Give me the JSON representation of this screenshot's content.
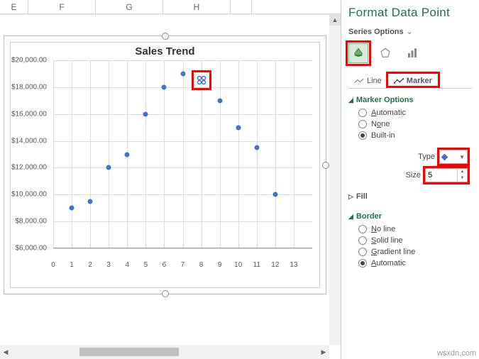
{
  "columns": [
    "E",
    "F",
    "G",
    "H"
  ],
  "chart_data": {
    "type": "scatter",
    "title": "Sales Trend",
    "ylabel": "",
    "xlabel": "",
    "ylim": [
      6000,
      20000
    ],
    "xlim": [
      0,
      14
    ],
    "y_ticks": [
      "$6,000.00",
      "$8,000.00",
      "$10,000.00",
      "$12,000.00",
      "$14,000.00",
      "$16,000.00",
      "$18,000.00",
      "$20,000.00"
    ],
    "x_ticks": [
      0,
      1,
      2,
      3,
      4,
      5,
      6,
      7,
      8,
      9,
      10,
      11,
      12,
      13
    ],
    "series": [
      {
        "name": "Sales",
        "points": [
          {
            "x": 1,
            "y": 9000
          },
          {
            "x": 2,
            "y": 9500
          },
          {
            "x": 3,
            "y": 12000
          },
          {
            "x": 4,
            "y": 13000
          },
          {
            "x": 5,
            "y": 16000
          },
          {
            "x": 6,
            "y": 18000
          },
          {
            "x": 7,
            "y": 19000
          },
          {
            "x": 8,
            "y": 18500
          },
          {
            "x": 9,
            "y": 17000
          },
          {
            "x": 10,
            "y": 15000
          },
          {
            "x": 11,
            "y": 13500
          },
          {
            "x": 12,
            "y": 10000
          }
        ]
      }
    ],
    "selected_point_index": 7
  },
  "pane": {
    "title": "Format Data Point",
    "series_options": "Series Options",
    "tabs": {
      "line": "Line",
      "marker": "Marker"
    },
    "marker_options": {
      "label": "Marker Options",
      "automatic": "Automatic",
      "none": "None",
      "builtin": "Built-in",
      "type_label": "Type",
      "size_label": "Size",
      "size_value": "5"
    },
    "fill_label": "Fill",
    "border": {
      "label": "Border",
      "no_line": "No line",
      "solid_line": "Solid line",
      "gradient_line": "Gradient line",
      "automatic": "Automatic"
    }
  },
  "watermark": "wsxdn.com"
}
